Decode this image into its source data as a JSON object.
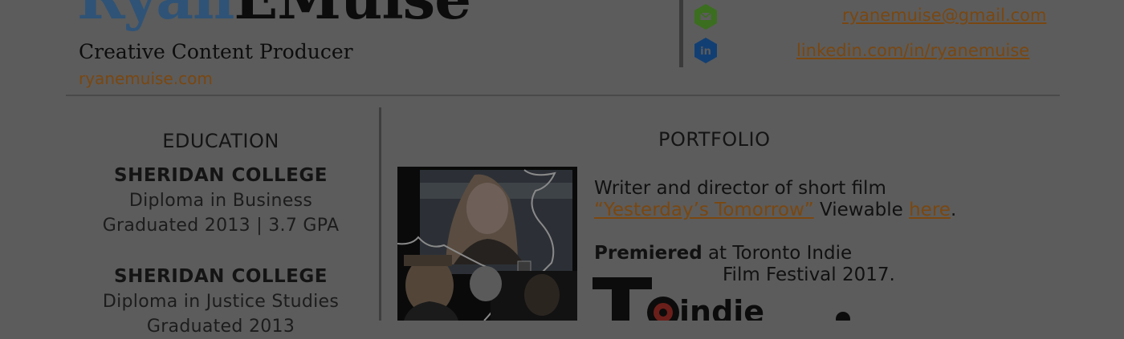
{
  "header": {
    "first_name": "Ryan",
    "last_name": "EMuise",
    "role": "Creative Content Producer",
    "website": "ryanemuise.com"
  },
  "contacts": [
    {
      "icon": "envelope-icon",
      "color": "#3b6e1f",
      "text": "ryanemuise@gmail.com"
    },
    {
      "icon": "linkedin-icon",
      "color": "#123f73",
      "text": "linkedin.com/in/ryanemuise"
    }
  ],
  "education": {
    "heading": "EDUCATION",
    "entries": [
      {
        "school": "SHERIDAN COLLEGE",
        "program": "Diploma in Business",
        "details": "Graduated 2013 | 3.7 GPA"
      },
      {
        "school": "SHERIDAN COLLEGE",
        "program": "Diploma in Justice Studies",
        "details": "Graduated 2013"
      }
    ]
  },
  "portfolio": {
    "heading": "PORTFOLIO",
    "line1": "Writer and director of short film",
    "film_title": "“Yesterday’s Tomorrow”",
    "viewable_text": " Viewable ",
    "here_link": "here",
    "period": ".",
    "premiered_bold": "Premiered",
    "premiered_rest": " at Toronto Indie",
    "festival_line": "Film Festival 2017.",
    "logo_text": "indie"
  },
  "colors": {
    "accent_blue": "#2f5376",
    "link_orange": "#7a4710"
  }
}
